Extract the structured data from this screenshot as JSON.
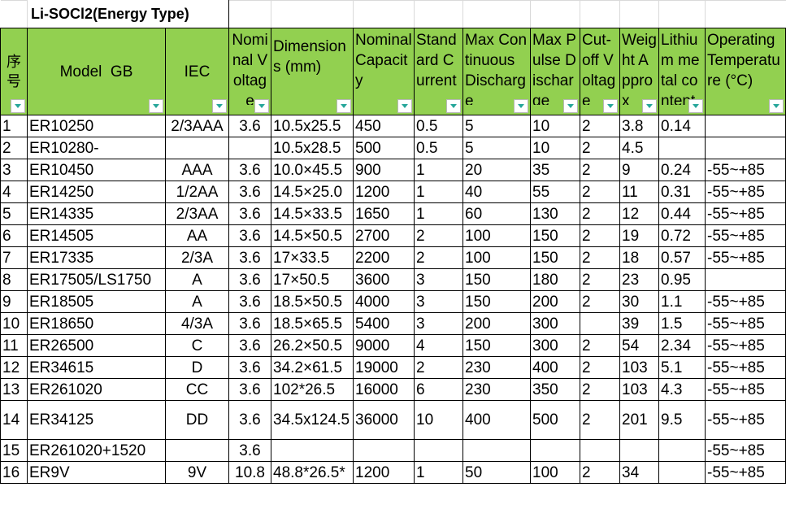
{
  "sheet": {
    "title": "Li-SOCl2(Energy Type)",
    "headers": {
      "seq": "序号",
      "model": "Model  GB",
      "iec": "IEC",
      "voltage": "Nominal Voltage",
      "dimensions": "Dimensions (mm)",
      "capacity": "Nominal Capacity",
      "std_current": "Standard Current",
      "max_cont": "Max Continuous Discharge",
      "max_pulse": "Max Pulse Discharge",
      "cutoff": "Cut-off Voltage",
      "weight": "Weight Approx",
      "lithium": "Lithium metal content",
      "temp": "Operating Temperature (°C)"
    },
    "rows": [
      {
        "seq": "1",
        "model": "ER10250",
        "iec": "2/3AAA",
        "voltage": "3.6",
        "dim": "10.5x25.5",
        "cap": "450",
        "std": "0.5",
        "cont": "5",
        "pulse": "10",
        "cutoff": "2",
        "weight": "3.8",
        "li": "0.14",
        "temp": ""
      },
      {
        "seq": "2",
        "model": "ER10280-",
        "iec": "",
        "voltage": "",
        "dim": "10.5x28.5",
        "cap": "500",
        "std": "0.5",
        "cont": "5",
        "pulse": "10",
        "cutoff": "2",
        "weight": "4.5",
        "li": "",
        "temp": ""
      },
      {
        "seq": "3",
        "model": "ER10450",
        "iec": "AAA",
        "voltage": "3.6",
        "dim": "10.0×45.5",
        "cap": "900",
        "std": "1",
        "cont": "20",
        "pulse": "35",
        "cutoff": "2",
        "weight": "9",
        "li": "0.24",
        "temp": "-55~+85"
      },
      {
        "seq": "4",
        "model": "ER14250",
        "iec": "1/2AA",
        "voltage": "3.6",
        "dim": "14.5×25.0",
        "cap": "1200",
        "std": "1",
        "cont": "40",
        "pulse": "55",
        "cutoff": "2",
        "weight": "11",
        "li": "0.31",
        "temp": "-55~+85"
      },
      {
        "seq": "5",
        "model": "ER14335",
        "iec": "2/3AA",
        "voltage": "3.6",
        "dim": "14.5×33.5",
        "cap": "1650",
        "std": "1",
        "cont": "60",
        "pulse": "130",
        "cutoff": "2",
        "weight": "12",
        "li": "0.44",
        "temp": "-55~+85"
      },
      {
        "seq": "6",
        "model": "ER14505",
        "iec": "AA",
        "voltage": "3.6",
        "dim": "14.5×50.5",
        "cap": "2700",
        "std": "2",
        "cont": "100",
        "pulse": "150",
        "cutoff": "2",
        "weight": "19",
        "li": "0.72",
        "temp": "-55~+85"
      },
      {
        "seq": "7",
        "model": "ER17335",
        "iec": "2/3A",
        "voltage": "3.6",
        "dim": "17×33.5",
        "cap": "2200",
        "std": "2",
        "cont": "100",
        "pulse": "150",
        "cutoff": "2",
        "weight": "18",
        "li": "0.57",
        "temp": "-55~+85"
      },
      {
        "seq": "8",
        "model": "ER17505/LS1750",
        "iec": "A",
        "voltage": "3.6",
        "dim": "17×50.5",
        "cap": "3600",
        "std": "3",
        "cont": "150",
        "pulse": "180",
        "cutoff": "2",
        "weight": "23",
        "li": "0.95",
        "temp": ""
      },
      {
        "seq": "9",
        "model": "ER18505",
        "iec": "A",
        "voltage": "3.6",
        "dim": "18.5×50.5",
        "cap": "4000",
        "std": "3",
        "cont": "150",
        "pulse": "200",
        "cutoff": "2",
        "weight": "30",
        "li": "1.1",
        "temp": "-55~+85"
      },
      {
        "seq": "10",
        "model": "ER18650",
        "iec": "4/3A",
        "voltage": "3.6",
        "dim": "18.5×65.5",
        "cap": "5400",
        "std": "3",
        "cont": "200",
        "pulse": "300",
        "cutoff": "",
        "weight": "39",
        "li": "1.5",
        "temp": "-55~+85"
      },
      {
        "seq": "11",
        "model": "ER26500",
        "iec": "C",
        "voltage": "3.6",
        "dim": "26.2×50.5",
        "cap": "9000",
        "std": "4",
        "cont": "150",
        "pulse": "300",
        "cutoff": "2",
        "weight": "54",
        "li": "2.34",
        "temp": "-55~+85"
      },
      {
        "seq": "12",
        "model": "ER34615",
        "iec": "D",
        "voltage": "3.6",
        "dim": "34.2×61.5",
        "cap": "19000",
        "std": "2",
        "cont": "230",
        "pulse": "400",
        "cutoff": "2",
        "weight": "103",
        "li": "5.1",
        "temp": "-55~+85"
      },
      {
        "seq": "13",
        "model": "ER261020",
        "iec": "CC",
        "voltage": "3.6",
        "dim": "102*26.5",
        "cap": "16000",
        "std": "6",
        "cont": "230",
        "pulse": "350",
        "cutoff": "2",
        "weight": "103",
        "li": "4.3",
        "temp": "-55~+85"
      },
      {
        "seq": "14",
        "model": "ER34125",
        "iec": "DD",
        "voltage": "3.6",
        "dim": "34.5x124.5",
        "cap": "36000",
        "std": "10",
        "cont": "400",
        "pulse": "500",
        "cutoff": "2",
        "weight": "201",
        "li": "9.5",
        "temp": "-55~+85"
      },
      {
        "seq": "15",
        "model": "ER261020+1520",
        "iec": "",
        "voltage": "3.6",
        "dim": "",
        "cap": "",
        "std": "",
        "cont": "",
        "pulse": "",
        "cutoff": "",
        "weight": "",
        "li": "",
        "temp": "-55~+85"
      },
      {
        "seq": "16",
        "model": "ER9V",
        "iec": "9V",
        "voltage": "10.8",
        "dim": "48.8*26.5*",
        "cap": "1200",
        "std": "1",
        "cont": "50",
        "pulse": "100",
        "cutoff": "2",
        "weight": "34",
        "li": "",
        "temp": "-55~+85"
      }
    ]
  },
  "colors": {
    "header_bg": "#92d050",
    "filter_arrow": "#26a69a",
    "grid": "#000000"
  },
  "icons": {
    "filter": "filter-dropdown-icon"
  }
}
